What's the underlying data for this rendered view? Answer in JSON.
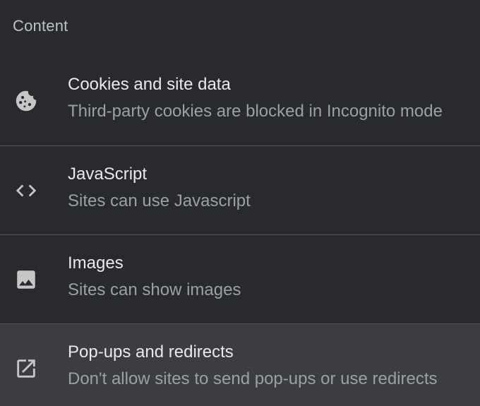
{
  "section": {
    "title": "Content"
  },
  "rows": [
    {
      "title": "Cookies and site data",
      "subtitle": "Third-party cookies are blocked in Incognito mode",
      "icon": "cookie-icon"
    },
    {
      "title": "JavaScript",
      "subtitle": "Sites can use Javascript",
      "icon": "code-icon"
    },
    {
      "title": "Images",
      "subtitle": "Sites can show images",
      "icon": "image-icon"
    },
    {
      "title": "Pop-ups and redirects",
      "subtitle": "Don't allow sites to send pop-ups or use redirects",
      "icon": "open-in-new-icon"
    }
  ],
  "colors": {
    "background": "#292a2d",
    "hover_row": "#3c3d40",
    "divider": "#55575b",
    "primary_text": "#e8eaed",
    "secondary_text": "#9aa0a6",
    "icon": "#c4c7c5"
  }
}
